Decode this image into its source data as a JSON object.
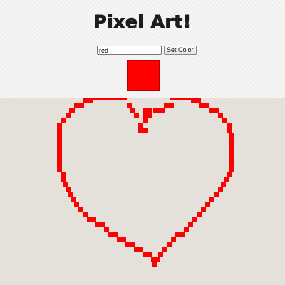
{
  "header": {
    "title": "Pixel Art!"
  },
  "controls": {
    "color_value": "red",
    "set_color_label": "Set Color"
  },
  "selected_color": "#ff0000",
  "colors": {
    "pixel": "#ff0000",
    "canvas_background": "#e4e1da",
    "header_background": "#f6f6f6"
  }
}
